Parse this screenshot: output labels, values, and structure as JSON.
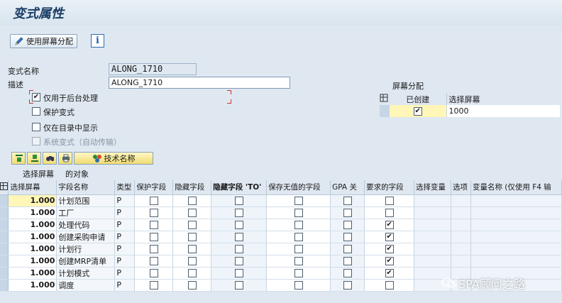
{
  "page": {
    "title": "变式属性"
  },
  "toolbar": {
    "assign_screen_label": "使用屏幕分配",
    "info_label": "i"
  },
  "form": {
    "variant_name_label": "变式名称",
    "variant_name_value": "ALONG_1710",
    "description_label": "描述",
    "description_value": "ALONG_1710",
    "checkboxes": [
      {
        "label": "仅用于后台处理",
        "checked": true,
        "disabled": false
      },
      {
        "label": "保护变式",
        "checked": false,
        "disabled": false
      },
      {
        "label": "仅在目录中显示",
        "checked": false,
        "disabled": false
      },
      {
        "label": "系统变式（自动传输）",
        "checked": false,
        "disabled": true
      }
    ]
  },
  "screen_assign": {
    "title": "屏幕分配",
    "col_created": "已创建",
    "col_select_screen": "选择屏幕",
    "rows": [
      {
        "created": true,
        "screen": "1000"
      }
    ]
  },
  "grid_toolbar": {
    "tech_name_label": "技术名称"
  },
  "objects_header": {
    "left": "选择屏幕",
    "right": "的对象"
  },
  "table": {
    "columns": [
      "选择屏幕",
      "字段名称",
      "类型",
      "保护字段",
      "隐藏字段",
      "隐藏字段 'TO'",
      "保存无值的字段",
      "GPA 关",
      "要求的字段",
      "选择变量",
      "选项",
      "变量名称 (仅使用 F4 输"
    ],
    "rows": [
      {
        "screen": "1.000",
        "field": "计划范围",
        "type": "P",
        "protect": false,
        "hide": false,
        "hide_to": false,
        "save_empty": false,
        "gpa": false,
        "required": false
      },
      {
        "screen": "1.000",
        "field": "工厂",
        "type": "P",
        "protect": false,
        "hide": false,
        "hide_to": false,
        "save_empty": false,
        "gpa": false,
        "required": false
      },
      {
        "screen": "1.000",
        "field": "处理代码",
        "type": "P",
        "protect": false,
        "hide": false,
        "hide_to": false,
        "save_empty": false,
        "gpa": false,
        "required": true
      },
      {
        "screen": "1.000",
        "field": "创建采购申请",
        "type": "P",
        "protect": false,
        "hide": false,
        "hide_to": false,
        "save_empty": false,
        "gpa": false,
        "required": true
      },
      {
        "screen": "1.000",
        "field": "计划行",
        "type": "P",
        "protect": false,
        "hide": false,
        "hide_to": false,
        "save_empty": false,
        "gpa": false,
        "required": true
      },
      {
        "screen": "1.000",
        "field": "创建MRP清单",
        "type": "P",
        "protect": false,
        "hide": false,
        "hide_to": false,
        "save_empty": false,
        "gpa": false,
        "required": true
      },
      {
        "screen": "1.000",
        "field": "计划模式",
        "type": "P",
        "protect": false,
        "hide": false,
        "hide_to": false,
        "save_empty": false,
        "gpa": false,
        "required": true
      },
      {
        "screen": "1.000",
        "field": "调度",
        "type": "P",
        "protect": false,
        "hide": false,
        "hide_to": false,
        "save_empty": false,
        "gpa": false,
        "required": false
      }
    ]
  },
  "watermark": {
    "text": "SPA顾问之路"
  }
}
